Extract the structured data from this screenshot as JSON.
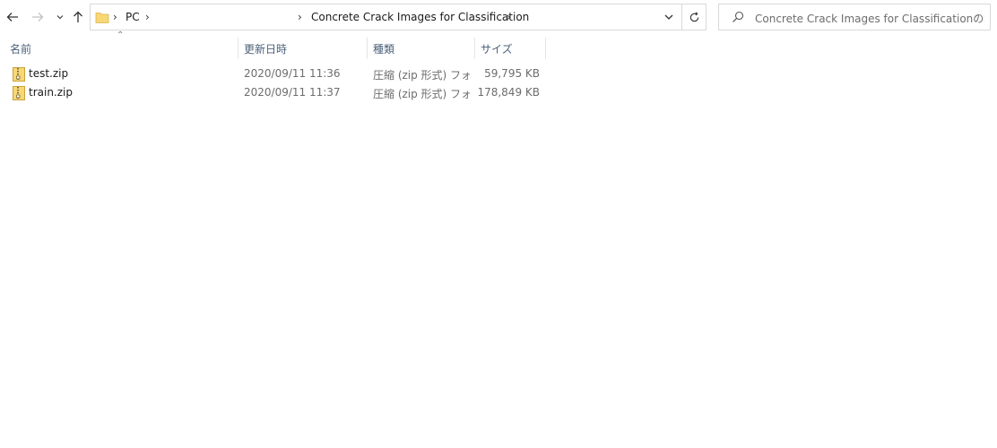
{
  "nav": {
    "back_icon": "arrow-left-icon",
    "forward_icon": "arrow-right-icon",
    "recent_icon": "chevron-down-icon",
    "up_icon": "arrow-up-icon"
  },
  "address": {
    "root": "PC",
    "current": "Concrete Crack Images for Classification"
  },
  "search": {
    "placeholder": "Concrete Crack Images for Classificationの検索"
  },
  "columns": {
    "name": "名前",
    "date": "更新日時",
    "type": "種類",
    "size": "サイズ"
  },
  "files": [
    {
      "name": "test.zip",
      "date": "2020/09/11 11:36",
      "type": "圧縮 (zip 形式) フォ...",
      "size": "59,795 KB"
    },
    {
      "name": "train.zip",
      "date": "2020/09/11 11:37",
      "type": "圧縮 (zip 形式) フォ...",
      "size": "178,849 KB"
    }
  ],
  "colors": {
    "folder": "#f8d775",
    "header_text": "#4c607a"
  }
}
